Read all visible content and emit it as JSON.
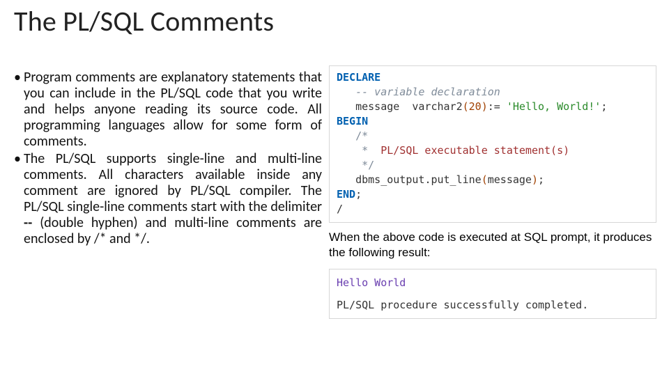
{
  "title": "The PL/SQL Comments",
  "bullets": {
    "b1": "Program comments are explanatory statements that you can include in the PL/SQL code that you write and helps anyone reading its source code. All programming languages allow for some form of comments.",
    "b2_a": "The PL/SQL supports single-line and multi-line comments. All characters available inside any comment are ignored by PL/SQL compiler. The PL/SQL single-line comments start with the delimiter",
    "b2_bold": " -- ",
    "b2_b": "(double hyphen) and multi-line comments are enclosed by /* and */."
  },
  "code": {
    "l1": "DECLARE",
    "l2_ind": "   ",
    "l2_cmt": "-- variable declaration",
    "l3_ind": "   ",
    "l3_a": "message  varchar2",
    "l3_paren_o": "(",
    "l3_num": "20",
    "l3_paren_c": ")",
    "l3_op": ":= ",
    "l3_str": "'Hello, World!'",
    "l3_semi": ";",
    "l4": "BEGIN",
    "l5_ind": "   ",
    "l5": "/*",
    "l6_ind": "    ",
    "l6_star": "*  ",
    "l6_txt": "PL/SQL executable statement(s)",
    "l7_ind": "    ",
    "l7": "*/",
    "l8_ind": "   ",
    "l8_fn": "dbms_output",
    "l8_dot": ".",
    "l8_put": "put_line",
    "l8_po": "(",
    "l8_arg": "message",
    "l8_pc": ")",
    "l8_semi": ";",
    "l9": "END",
    "l9_semi": ";",
    "l10": "/"
  },
  "result_caption": "When the above code is executed at SQL prompt, it produces the following result:",
  "result": {
    "r1": "Hello World",
    "r2": "PL/SQL procedure successfully completed."
  }
}
